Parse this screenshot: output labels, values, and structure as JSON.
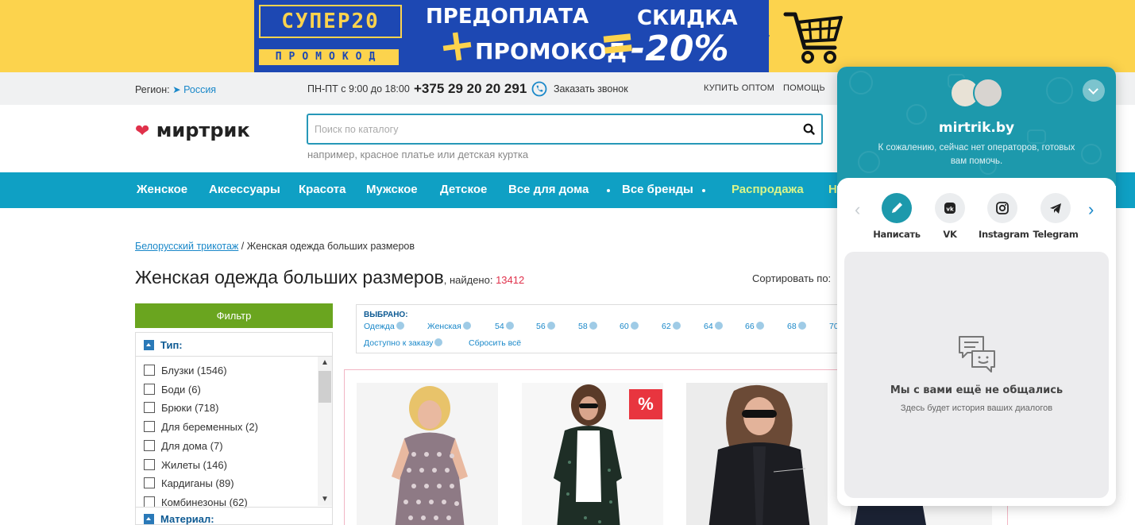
{
  "promo": {
    "super": "СУПЕР20",
    "promokod_small": "ПРОМОКОД",
    "prepay": "ПРЕДОПЛАТА",
    "promokod": "ПРОМОКОД",
    "discount_word": "СКИДКА",
    "discount_value": "-20%"
  },
  "infobar": {
    "region_label": "Регион:",
    "region_value": "Россия",
    "hours": "ПН-ПТ с 9:00 до 18:00",
    "phone": "+375 29 20 20 291",
    "callback": "Заказать звонок",
    "wholesale": "КУПИТЬ ОПТОМ",
    "help": "ПОМОЩЬ"
  },
  "header": {
    "logo": "миртрик",
    "search_placeholder": "Поиск по каталогу",
    "search_hint": "например, красное платье или детская куртка"
  },
  "nav": {
    "items": [
      "Женское",
      "Аксессуары",
      "Красота",
      "Мужское",
      "Детское",
      "Все для дома",
      "Все бренды",
      "Распродажа",
      "Н"
    ]
  },
  "breadcrumb": {
    "link": "Белорусский трикотаж",
    "sep": " / ",
    "current": "Женская одежда больших размеров"
  },
  "page": {
    "title": "Женская одежда больших размеров",
    "found_label": ", найдено: ",
    "found_count": "13412",
    "sort_label": "Сортировать по:"
  },
  "filter": {
    "button": "Фильтр",
    "type_label": "Тип:",
    "items": [
      "Блузки (1546)",
      "Боди (6)",
      "Брюки (718)",
      "Для беременных (2)",
      "Для дома (7)",
      "Жилеты (146)",
      "Кардиганы (89)",
      "Комбинезоны (62)"
    ],
    "material_label": "Материал:"
  },
  "selected": {
    "title": "ВЫБРАНО:",
    "chips": [
      "Одежда",
      "Женская",
      "54",
      "56",
      "58",
      "60",
      "62",
      "64",
      "66",
      "68",
      "70"
    ],
    "available": "Доступно к заказу",
    "reset": "Сбросить всё"
  },
  "products": {
    "sale_badge": "%"
  },
  "chat": {
    "name": "mirtrik.by",
    "status": "К сожалению, сейчас нет операторов, готовых вам помочь.",
    "channels": [
      "Написать",
      "VK",
      "Instagram",
      "Telegram"
    ],
    "history_title": "Мы с вами ещё не общались",
    "history_sub": "Здесь будет история ваших диалогов"
  },
  "colors": {
    "banner_yellow": "#fcd34d",
    "banner_blue": "#1d48b3",
    "nav_teal": "#0fa0c4",
    "filter_green": "#6aa51f",
    "chat_teal": "#1d99ac",
    "accent_red": "#e0314b"
  }
}
